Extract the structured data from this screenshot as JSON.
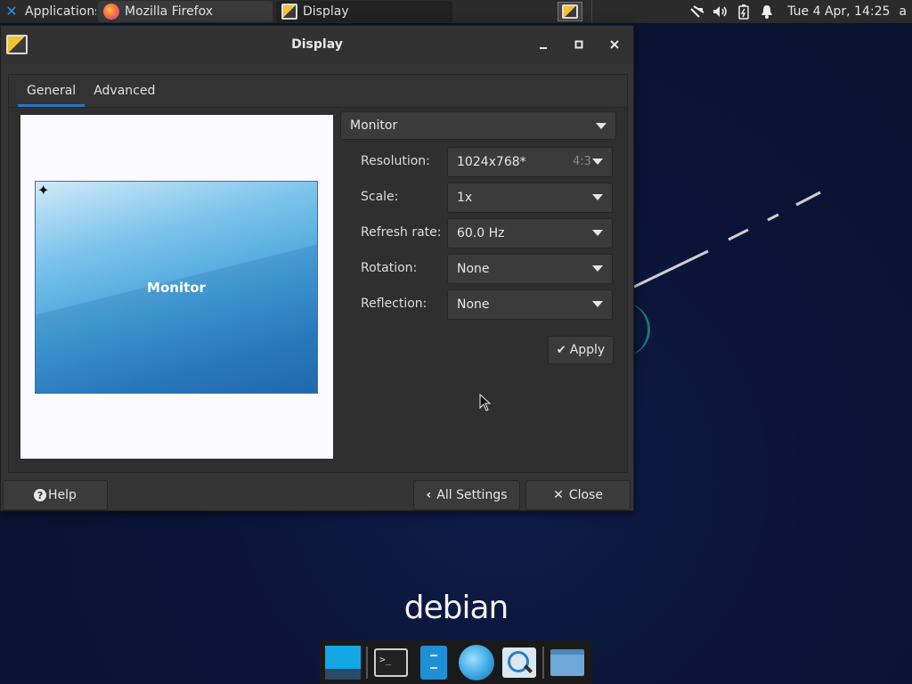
{
  "top_panel": {
    "applications_label": "Applications",
    "tasks": [
      {
        "label": "Mozilla Firefox",
        "icon": "firefox-icon"
      },
      {
        "label": "Display",
        "icon": "display-settings-icon"
      }
    ],
    "clock": "Tue  4 Apr, 14:25",
    "user": "a",
    "tray_icons": [
      "network-icon",
      "volume-icon",
      "battery-icon",
      "notification-bell-icon"
    ]
  },
  "window": {
    "title": "Display",
    "tabs": [
      {
        "label": "General",
        "active": true
      },
      {
        "label": "Advanced",
        "active": false
      }
    ],
    "preview": {
      "monitor_label": "Monitor"
    },
    "monitor_select": "Monitor",
    "settings": [
      {
        "label": "Resolution:",
        "value": "1024x768*",
        "hint": "4:3"
      },
      {
        "label": "Scale:",
        "value": "1x"
      },
      {
        "label": "Refresh rate:",
        "value": "60.0 Hz"
      },
      {
        "label": "Rotation:",
        "value": "None"
      },
      {
        "label": "Reflection:",
        "value": "None"
      }
    ],
    "apply_label": "Apply",
    "help_label": "Help",
    "all_settings_label": "All Settings",
    "close_label": "Close"
  },
  "desktop": {
    "logo_text": "debian"
  },
  "colors": {
    "accent": "#2a76c6",
    "window_bg": "#353535",
    "desktop_bg": "#0c1538",
    "panel_bg": "#2b2b2b"
  }
}
